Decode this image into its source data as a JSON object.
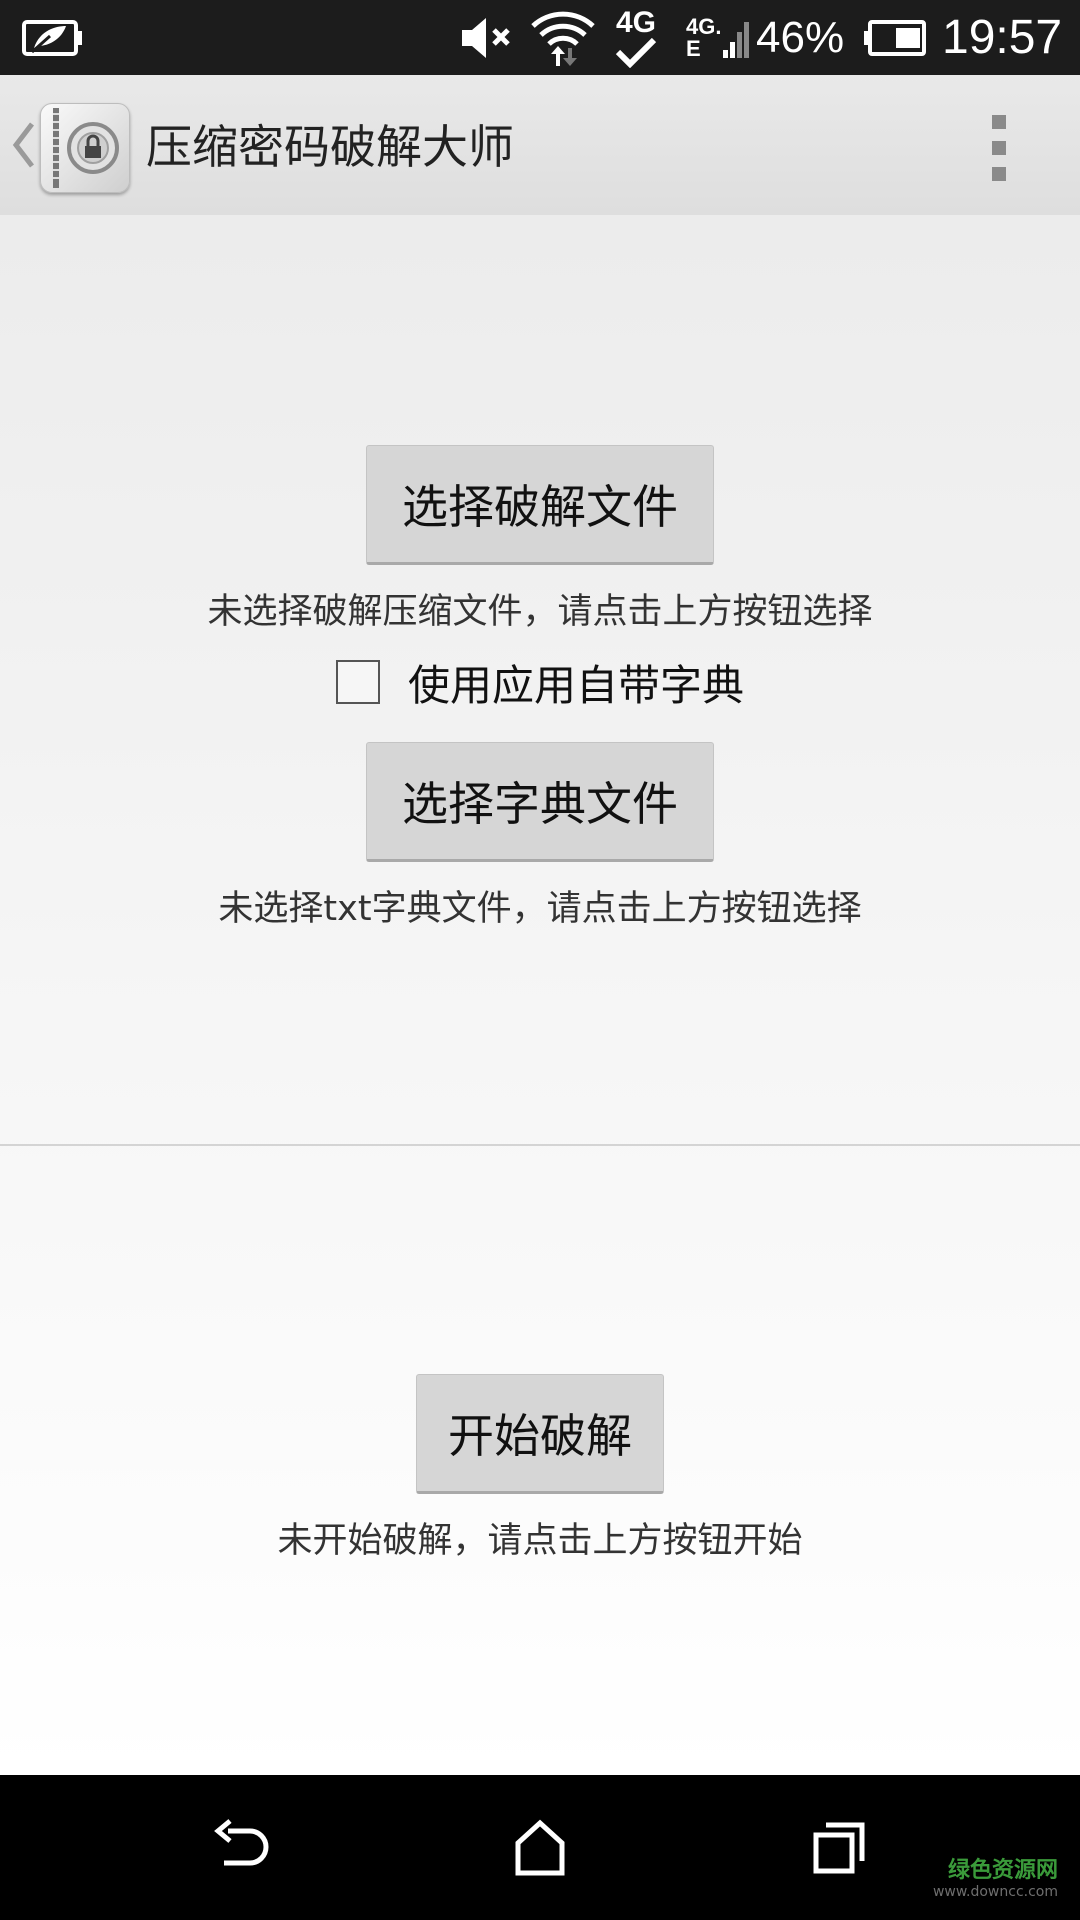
{
  "status_bar": {
    "battery_percent": "46%",
    "clock": "19:57",
    "network_top": "4G",
    "network_small_top": "4G.",
    "network_small_bottom": "E",
    "icons": [
      "battery-saver-icon",
      "mute-icon",
      "wifi-icon",
      "data-sync-icon",
      "signal-icon",
      "battery-icon"
    ]
  },
  "action_bar": {
    "title": "压缩密码破解大师",
    "icons": [
      "up-caret-icon",
      "app-icon",
      "overflow-menu-icon"
    ]
  },
  "main": {
    "select_file_button": "选择破解文件",
    "select_file_hint": "未选择破解压缩文件，请点击上方按钮选择",
    "builtin_dict_checkbox": {
      "label": "使用应用自带字典",
      "checked": false
    },
    "select_dict_button": "选择字典文件",
    "select_dict_hint": "未选择txt字典文件，请点击上方按钮选择",
    "start_button": "开始破解",
    "start_hint": "未开始破解，请点击上方按钮开始"
  },
  "nav_bar": {
    "icons": [
      "back-icon",
      "home-icon",
      "recents-icon"
    ],
    "watermark": "绿色资源网",
    "watermark_url": "www.downcc.com"
  },
  "colors": {
    "status_bar_bg": "#1c1c1c",
    "action_bar_bg": "#e3e3e3",
    "button_bg": "#d6d6d6",
    "nav_bar_bg": "#000000",
    "watermark_green": "#3a9a3a"
  }
}
